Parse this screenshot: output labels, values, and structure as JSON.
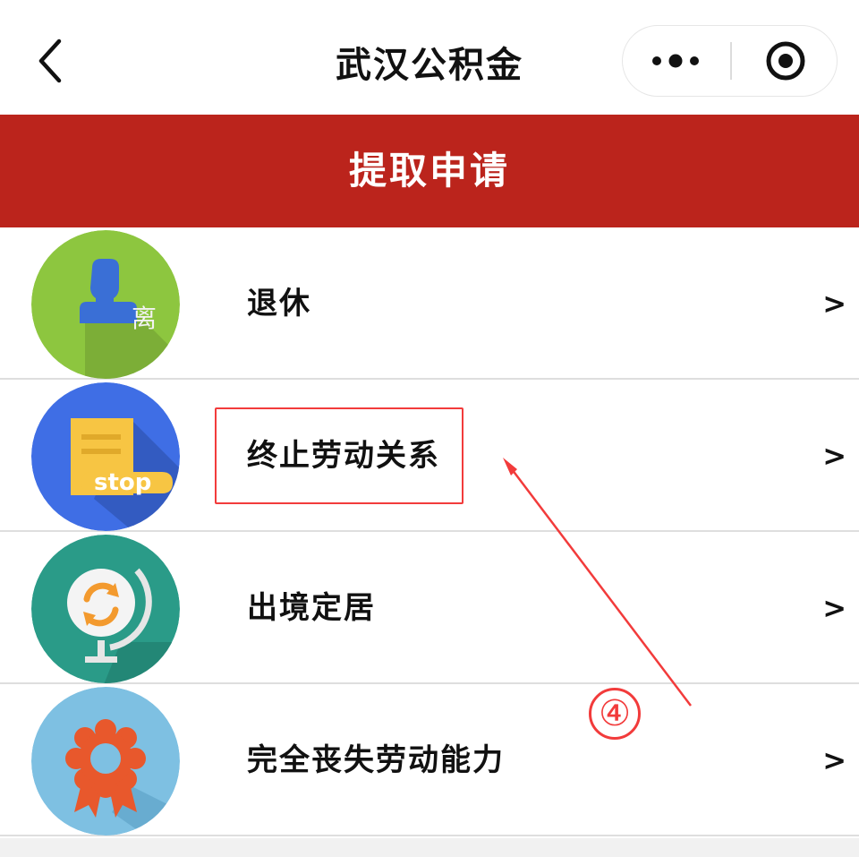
{
  "nav": {
    "title": "武汉公积金",
    "back_icon": "chevron-left-icon",
    "more_icon": "more-dots-icon",
    "close_icon": "target-circle-icon"
  },
  "banner": {
    "title": "提取申请",
    "color": "#bb241c"
  },
  "items": [
    {
      "label": "退休",
      "icon": "retire-person-icon",
      "icon_color": "#8dc63f",
      "chevron": ">"
    },
    {
      "label": "终止劳动关系",
      "icon": "stop-document-icon",
      "icon_color": "#3f6ee5",
      "chevron": ">"
    },
    {
      "label": "出境定居",
      "icon": "globe-icon",
      "icon_color": "#2a9b88",
      "chevron": ">"
    },
    {
      "label": "完全丧失劳动能力",
      "icon": "award-badge-icon",
      "icon_color": "#7ec0e2",
      "chevron": ">"
    }
  ],
  "annotation": {
    "step": "④",
    "color": "#f23b3b"
  }
}
